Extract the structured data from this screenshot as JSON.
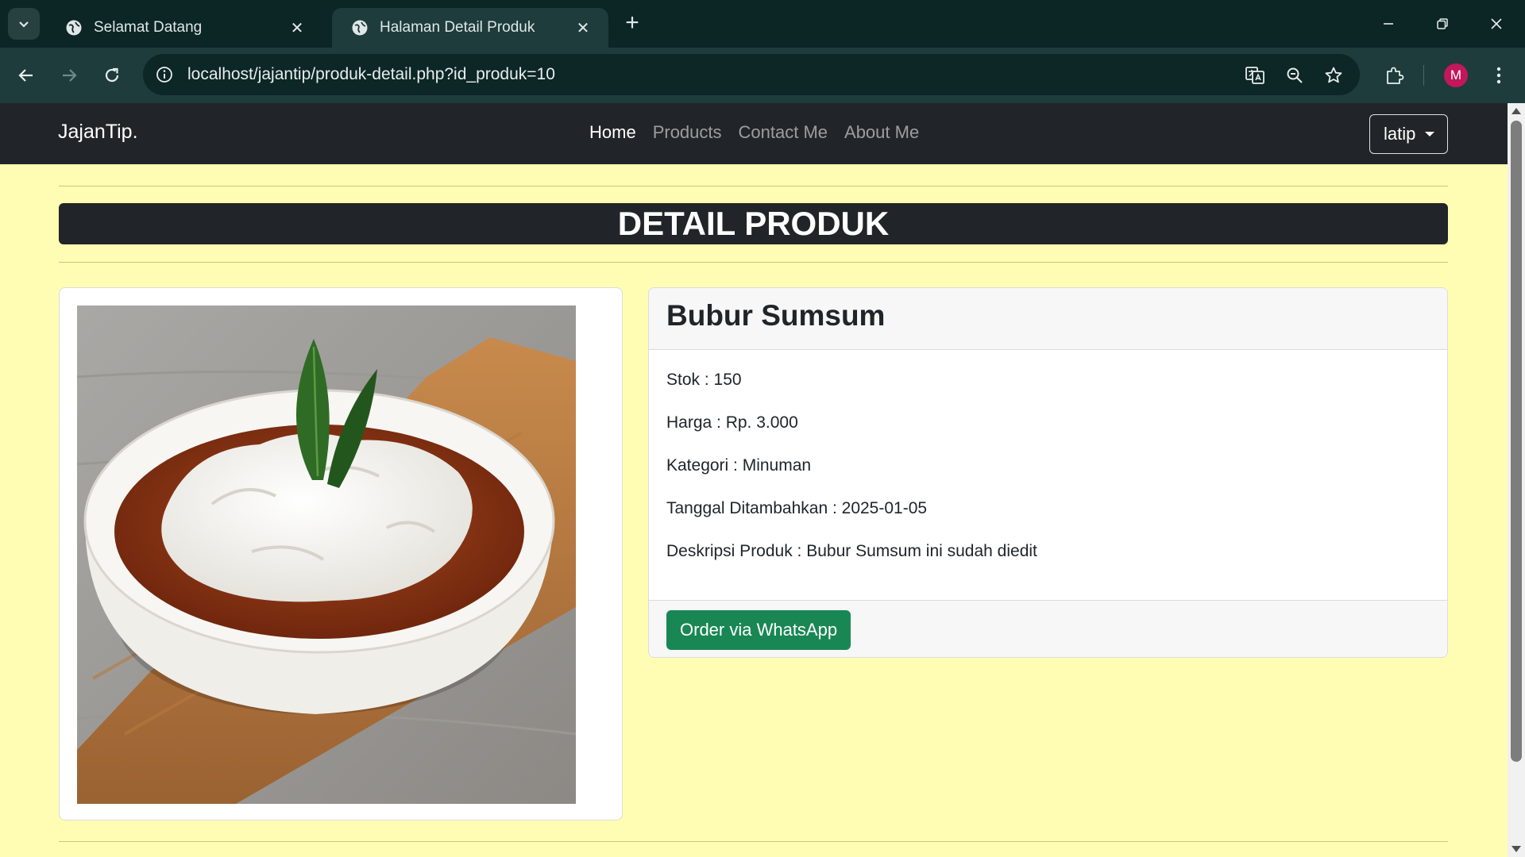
{
  "browser": {
    "tabs": [
      {
        "title": "Selamat Datang",
        "active": false
      },
      {
        "title": "Halaman Detail Produk",
        "active": true
      }
    ],
    "url": "localhost/jajantip/produk-detail.php?id_produk=10",
    "profile_initial": "M",
    "profile_color": "#c2185b"
  },
  "navbar": {
    "brand": "JajanTip.",
    "links": [
      "Home",
      "Products",
      "Contact Me",
      "About Me"
    ],
    "active_link": "Home",
    "user": "latip"
  },
  "page": {
    "title": "DETAIL PRODUK",
    "background": "#fefdb3"
  },
  "product": {
    "name": "Bubur Sumsum",
    "details": [
      "Stok : 150",
      "Harga : Rp. 3.000",
      "Kategori : Minuman",
      "Tanggal Ditambahkan : 2025-01-05",
      "Deskripsi Produk : Bubur Sumsum ini sudah diedit"
    ],
    "order_button": "Order via WhatsApp",
    "order_button_color": "#198754"
  }
}
